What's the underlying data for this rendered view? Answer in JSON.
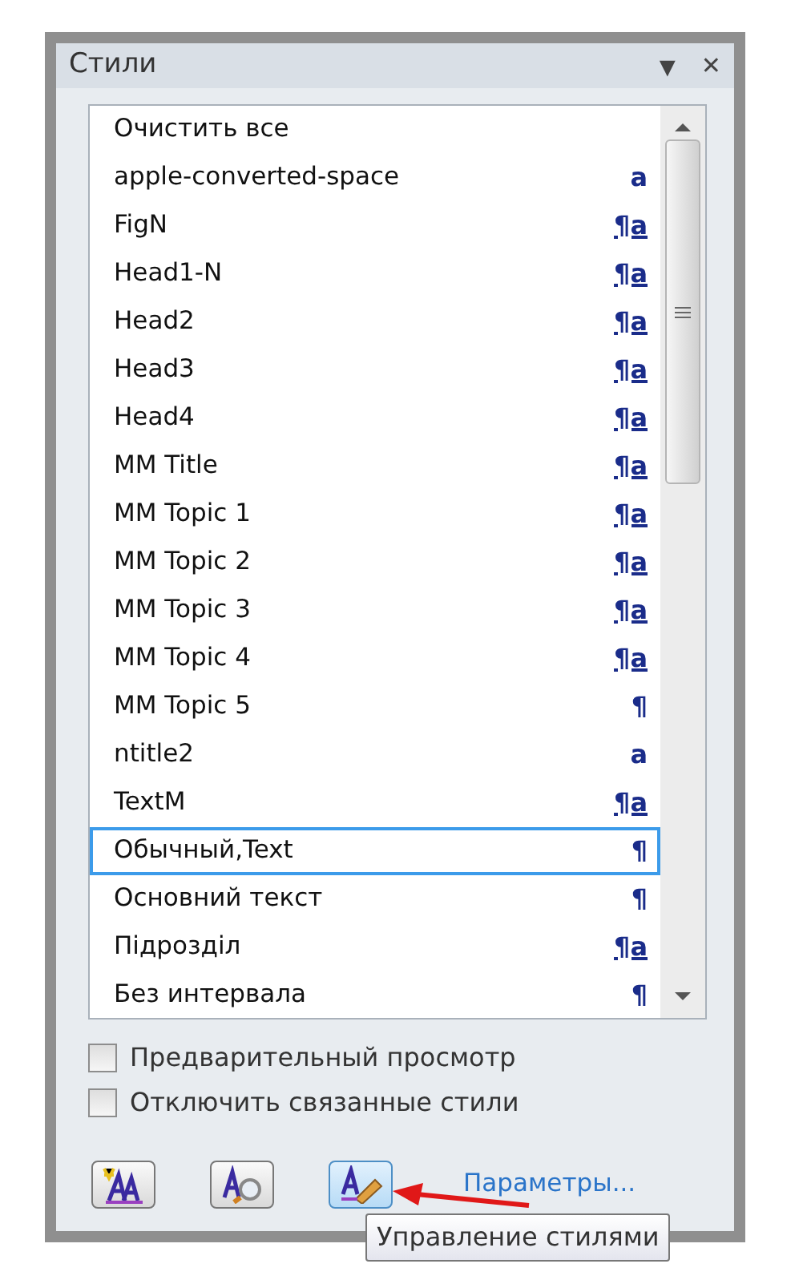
{
  "pane": {
    "title": "Стили",
    "menu_glyph": "▾",
    "close_glyph": "✕"
  },
  "styles": [
    {
      "name": "Очистить все",
      "kind": "none",
      "selected": false
    },
    {
      "name": "apple-converted-space",
      "kind": "character",
      "mark": "a",
      "selected": false
    },
    {
      "name": "FigN",
      "kind": "linked",
      "mark": "¶a",
      "selected": false
    },
    {
      "name": "Head1-N",
      "kind": "linked",
      "mark": "¶a",
      "selected": false
    },
    {
      "name": "Head2",
      "kind": "linked",
      "mark": "¶a",
      "selected": false
    },
    {
      "name": "Head3",
      "kind": "linked",
      "mark": "¶a",
      "selected": false
    },
    {
      "name": "Head4",
      "kind": "linked",
      "mark": "¶a",
      "selected": false
    },
    {
      "name": "MM Title",
      "kind": "linked",
      "mark": "¶a",
      "selected": false
    },
    {
      "name": "MM Topic 1",
      "kind": "linked",
      "mark": "¶a",
      "selected": false
    },
    {
      "name": "MM Topic 2",
      "kind": "linked",
      "mark": "¶a",
      "selected": false
    },
    {
      "name": "MM Topic 3",
      "kind": "linked",
      "mark": "¶a",
      "selected": false
    },
    {
      "name": "MM Topic 4",
      "kind": "linked",
      "mark": "¶a",
      "selected": false
    },
    {
      "name": "MM Topic 5",
      "kind": "paragraph",
      "mark": "¶",
      "selected": false
    },
    {
      "name": "ntitle2",
      "kind": "character",
      "mark": "a",
      "selected": false
    },
    {
      "name": "TextM",
      "kind": "linked",
      "mark": "¶a",
      "selected": false
    },
    {
      "name": "Обычный,Text",
      "kind": "paragraph",
      "mark": "¶",
      "selected": true
    },
    {
      "name": "Основний текст",
      "kind": "paragraph",
      "mark": "¶",
      "selected": false
    },
    {
      "name": "Підрозділ",
      "kind": "linked",
      "mark": "¶a",
      "selected": false
    },
    {
      "name": "Без интервала",
      "kind": "paragraph",
      "mark": "¶",
      "selected": false
    }
  ],
  "options": [
    {
      "label": "Предварительный просмотр",
      "checked": false
    },
    {
      "label": "Отключить связанные стили",
      "checked": false
    }
  ],
  "toolbar": [
    {
      "kind": "new",
      "selected": false
    },
    {
      "kind": "inspect",
      "selected": false
    },
    {
      "kind": "manage",
      "selected": true
    }
  ],
  "options_link": "Параметры...",
  "tooltip": "Управление стилями"
}
